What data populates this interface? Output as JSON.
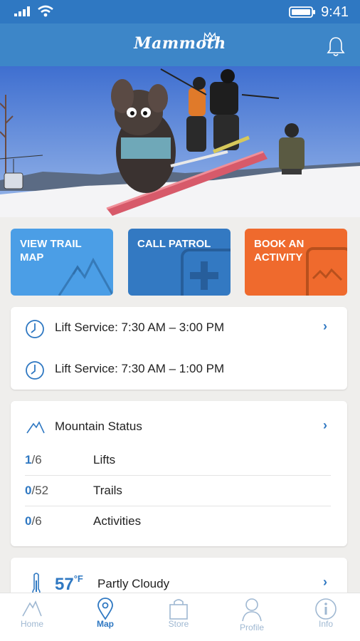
{
  "status_bar": {
    "time": "9:41"
  },
  "app_bar": {
    "logo": "Mammoth",
    "icons": [
      "crown-icon",
      "bell-icon"
    ]
  },
  "tiles": [
    {
      "label": "VIEW TRAIL MAP",
      "icon": "mountain-icon",
      "color": "#4b9ee6"
    },
    {
      "label": "CALL PATROL",
      "icon": "plus-icon",
      "color": "#3379c2"
    },
    {
      "label": "BOOK AN ACTIVITY",
      "icon": "photo-icon",
      "color": "#ef6a2d"
    }
  ],
  "lift_service": [
    {
      "text": "Lift Service: 7:30 AM – 3:00 PM"
    },
    {
      "text": "Lift Service: 7:30 AM – 1:00 PM"
    }
  ],
  "mountain_status": {
    "title": "Mountain Status",
    "rows": [
      {
        "open": "1",
        "total": "/6",
        "name": "Lifts"
      },
      {
        "open": "0",
        "total": "/52",
        "name": "Trails"
      },
      {
        "open": "0",
        "total": "/6",
        "name": "Activities"
      }
    ]
  },
  "weather": {
    "temp": "57",
    "unit": "°F",
    "condition": "Partly Cloudy"
  },
  "tabs": [
    {
      "label": "Home",
      "icon": "mountain-icon"
    },
    {
      "label": "Map",
      "icon": "map-pin-icon",
      "active": true
    },
    {
      "label": "Store",
      "icon": "shopping-bag-icon"
    },
    {
      "label": "Profile",
      "icon": "person-icon"
    },
    {
      "label": "Info",
      "icon": "info-icon"
    }
  ],
  "colors": {
    "primary": "#2f78c2",
    "appbar": "#3d86c8",
    "orange": "#ef6a2d",
    "light_blue": "#4b9ee6"
  }
}
